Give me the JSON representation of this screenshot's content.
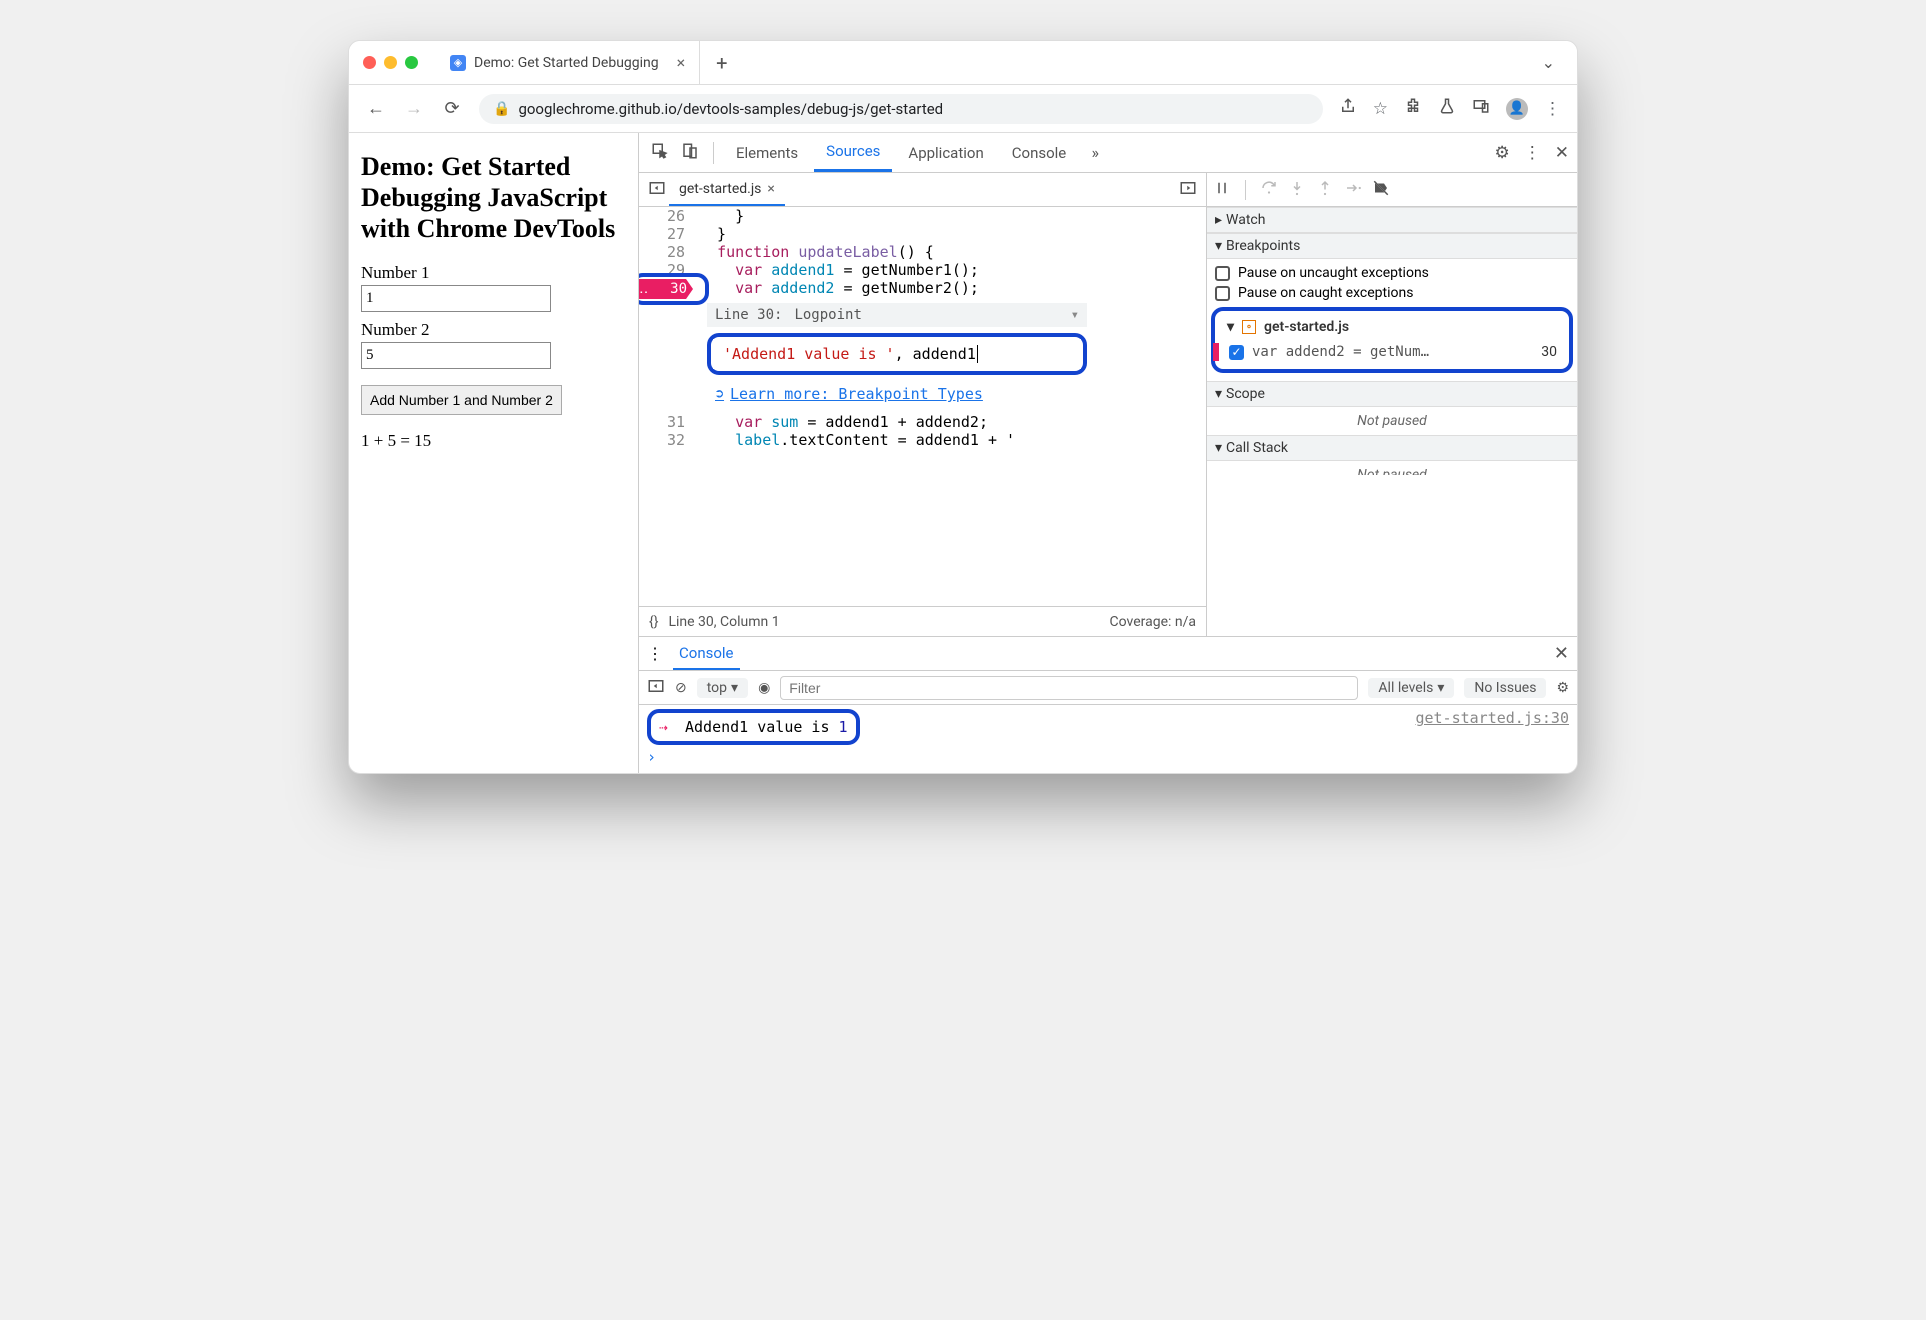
{
  "browser": {
    "tab_title": "Demo: Get Started Debugging",
    "url": "googlechrome.github.io/devtools-samples/debug-js/get-started"
  },
  "page": {
    "heading": "Demo: Get Started Debugging JavaScript with Chrome DevTools",
    "label1": "Number 1",
    "input1": "1",
    "label2": "Number 2",
    "input2": "5",
    "button": "Add Number 1 and Number 2",
    "result": "1 + 5 = 15"
  },
  "devtools": {
    "tabs": {
      "elements": "Elements",
      "sources": "Sources",
      "application": "Application",
      "console": "Console"
    },
    "file_tab": "get-started.js",
    "code": {
      "l26": "    }",
      "l27": "  }",
      "l28_kw": "function",
      "l28_fn": "updateLabel",
      "l28_rest": "() {",
      "l29_kw": "var",
      "l29_var": "addend1",
      "l29_rest": " = getNumber1();",
      "l30_kw": "var",
      "l30_var": "addend2",
      "l30_rest": " = getNumber2();",
      "l31_kw": "var",
      "l31_var": "sum",
      "l31_rest": " = addend1 + addend2;",
      "l32_var": "label",
      "l32_rest": ".textContent = addend1 + ' "
    },
    "line_numbers": {
      "n26": "26",
      "n27": "27",
      "n28": "28",
      "n29": "29",
      "n30": "30",
      "n31": "31",
      "n32": "32"
    },
    "bp_editor": {
      "title": "Line 30:",
      "type": "Logpoint",
      "expr_str": "'Addend1 value is '",
      "expr_rest": ", addend1",
      "learn": "Learn more: Breakpoint Types"
    },
    "status": {
      "braces": "{}",
      "pos": "Line 30, Column 1",
      "coverage": "Coverage: n/a"
    },
    "dbg": {
      "watch": "Watch",
      "breakpoints": "Breakpoints",
      "pause_uncaught": "Pause on uncaught exceptions",
      "pause_caught": "Pause on caught exceptions",
      "bp_file": "get-started.js",
      "bp_snippet": "var addend2 = getNum…",
      "bp_line": "30",
      "scope": "Scope",
      "not_paused": "Not paused",
      "callstack": "Call Stack",
      "not_paused2": "Not paused"
    },
    "drawer": {
      "tab": "Console",
      "context": "top",
      "filter_ph": "Filter",
      "levels": "All levels",
      "issues": "No Issues",
      "log_text": "Addend1 value is ",
      "log_val": "1",
      "log_src": "get-started.js:30"
    }
  }
}
